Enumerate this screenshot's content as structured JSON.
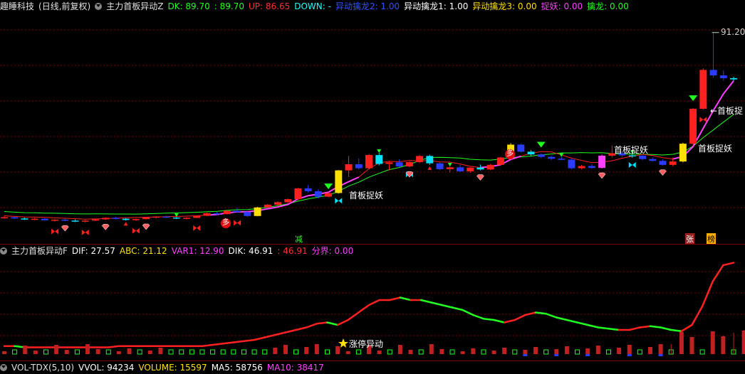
{
  "main_panel": {
    "stock_name": "趣睡科技",
    "period": "(日线,前复权)",
    "indicator": "主力首板异动Z",
    "dk": "DK: 89.70",
    "dk2": ": 89.70",
    "up": "UP: 86.65",
    "down": "DOWN: -",
    "yd2": "异动擒龙2: 1.00",
    "yd1": "异动擒龙1: 1.00",
    "yd3": "异动擒龙3: 0.00",
    "ty": "捉妖: 0.00",
    "ql": "擒龙: 0.00",
    "price_high_label": "91.20",
    "labels": {
      "sbzy1": "首板捉妖",
      "sbzy2": "首板捉妖",
      "sbzy3": "首板捉妖",
      "sbzy4": "←首板捉",
      "duo1": "多",
      "duo2": "多",
      "jian": "减",
      "zhang": "张",
      "bang": "榜"
    }
  },
  "sub_panel": {
    "indicator": "主力首板异动F",
    "dif": "DIF: 27.57",
    "abc": "ABC: 21.12",
    "var1": "VAR1: 12.90",
    "dik": "DIK: 46.91",
    "dik2": ": 46.91",
    "fj": "分界: 0.00",
    "zt_label": "涨停异动"
  },
  "vol_panel": {
    "indicator": "VOL-TDX(5,10)",
    "vvol": "VVOL: 94234",
    "volume": "VOLUME: 15597",
    "ma5": "MA5: 58756",
    "ma10": "MA10: 38417"
  },
  "colors": {
    "up": "#ff2020",
    "down": "#00e0ff",
    "blue": "#2a3cff",
    "yellow": "#ffe000",
    "magenta": "#ff40ff",
    "green": "#20ff20",
    "grid": "#7a0000"
  },
  "chart_data": {
    "type": "candlestick",
    "price_max_label": 91.2,
    "candles": [
      [
        30.6,
        31.2,
        30.4,
        30.9
      ],
      [
        30.9,
        31.0,
        30.3,
        30.5
      ],
      [
        30.5,
        30.8,
        30.0,
        30.2
      ],
      [
        30.2,
        30.7,
        29.9,
        30.4
      ],
      [
        30.4,
        30.6,
        29.8,
        29.9
      ],
      [
        29.9,
        30.3,
        29.5,
        30.1
      ],
      [
        30.1,
        30.5,
        29.6,
        29.8
      ],
      [
        29.8,
        30.2,
        29.3,
        29.5
      ],
      [
        29.5,
        30.0,
        29.2,
        29.8
      ],
      [
        29.8,
        30.4,
        29.6,
        30.2
      ],
      [
        30.2,
        30.9,
        30.0,
        30.7
      ],
      [
        30.7,
        31.0,
        30.2,
        30.4
      ],
      [
        30.4,
        30.6,
        29.8,
        30.0
      ],
      [
        30.0,
        30.4,
        29.7,
        30.3
      ],
      [
        30.3,
        30.9,
        30.1,
        30.8
      ],
      [
        30.8,
        31.3,
        30.5,
        31.1
      ],
      [
        31.1,
        31.4,
        30.6,
        30.8
      ],
      [
        30.8,
        31.0,
        30.3,
        30.5
      ],
      [
        30.5,
        30.9,
        30.2,
        30.7
      ],
      [
        30.7,
        31.5,
        30.6,
        31.4
      ],
      [
        31.4,
        32.4,
        31.2,
        32.2
      ],
      [
        32.2,
        32.6,
        31.6,
        31.9
      ],
      [
        31.9,
        33.2,
        31.8,
        33.0
      ],
      [
        33.0,
        34.0,
        32.3,
        32.6
      ],
      [
        32.6,
        33.6,
        31.0,
        31.3
      ],
      [
        31.3,
        34.3,
        31.2,
        34.1
      ],
      [
        34.1,
        35.2,
        33.9,
        35.0
      ],
      [
        35.0,
        36.1,
        34.6,
        35.8
      ],
      [
        35.8,
        37.0,
        35.5,
        36.8
      ],
      [
        36.8,
        40.5,
        36.5,
        40.3
      ],
      [
        40.3,
        41.4,
        39.0,
        39.4
      ],
      [
        39.4,
        40.0,
        37.0,
        37.6
      ],
      [
        37.6,
        39.1,
        37.4,
        38.8
      ],
      [
        38.8,
        46.3,
        38.6,
        46.2
      ],
      [
        46.2,
        50.9,
        44.0,
        48.2
      ],
      [
        48.2,
        50.1,
        46.5,
        46.9
      ],
      [
        46.9,
        51.5,
        46.6,
        51.2
      ],
      [
        51.2,
        51.9,
        47.8,
        48.3
      ],
      [
        48.3,
        49.0,
        46.2,
        48.8
      ],
      [
        48.8,
        49.8,
        47.2,
        47.5
      ],
      [
        47.5,
        49.1,
        47.2,
        48.9
      ],
      [
        48.9,
        51.2,
        48.6,
        50.9
      ],
      [
        50.9,
        51.3,
        48.0,
        48.5
      ],
      [
        48.5,
        49.0,
        46.3,
        46.6
      ],
      [
        46.6,
        47.5,
        45.5,
        47.2
      ],
      [
        47.2,
        48.0,
        45.6,
        45.9
      ],
      [
        45.9,
        47.3,
        45.4,
        47.1
      ],
      [
        47.1,
        48.1,
        46.2,
        46.5
      ],
      [
        46.5,
        48.3,
        46.3,
        48.0
      ],
      [
        48.0,
        50.6,
        47.8,
        50.4
      ],
      [
        50.4,
        55.1,
        50.2,
        54.6
      ],
      [
        54.6,
        54.9,
        52.0,
        52.3
      ],
      [
        52.3,
        52.8,
        51.0,
        51.4
      ],
      [
        51.4,
        51.8,
        50.2,
        50.6
      ],
      [
        50.6,
        51.0,
        49.6,
        50.0
      ],
      [
        50.0,
        50.6,
        49.5,
        49.7
      ],
      [
        49.7,
        50.0,
        46.6,
        46.9
      ],
      [
        46.9,
        48.0,
        46.5,
        47.6
      ],
      [
        47.6,
        48.2,
        46.8,
        47.0
      ],
      [
        47.0,
        51.4,
        46.8,
        51.0
      ],
      [
        51.0,
        54.3,
        50.4,
        51.8
      ],
      [
        51.8,
        52.4,
        50.6,
        51.1
      ],
      [
        51.1,
        51.6,
        50.3,
        51.0
      ],
      [
        51.0,
        51.3,
        49.6,
        49.9
      ],
      [
        49.9,
        50.4,
        49.0,
        49.3
      ],
      [
        49.3,
        49.7,
        47.8,
        48.0
      ],
      [
        48.0,
        50.4,
        47.6,
        49.1
      ],
      [
        49.1,
        55.2,
        48.8,
        54.9
      ],
      [
        54.9,
        66.5,
        54.4,
        66.3
      ],
      [
        66.3,
        79.5,
        66.0,
        79.0
      ],
      [
        79.0,
        91.2,
        76.5,
        77.2
      ],
      [
        77.2,
        78.8,
        75.5,
        76.3
      ],
      [
        76.3,
        76.8,
        75.4,
        75.9
      ]
    ],
    "sub_line": [
      3,
      3,
      2,
      2,
      2,
      2,
      2,
      2,
      2,
      2,
      2,
      3,
      3,
      3,
      3,
      3,
      3,
      3,
      3,
      3,
      4,
      5,
      6,
      7,
      8,
      10,
      12,
      14,
      16,
      18,
      21,
      22,
      20,
      24,
      30,
      36,
      40,
      40,
      42,
      40,
      40,
      38,
      36,
      34,
      32,
      28,
      25,
      24,
      22,
      24,
      28,
      30,
      29,
      26,
      24,
      22,
      20,
      18,
      17,
      16,
      16,
      18,
      19,
      18,
      16,
      15,
      20,
      35,
      55,
      68,
      70
    ]
  }
}
